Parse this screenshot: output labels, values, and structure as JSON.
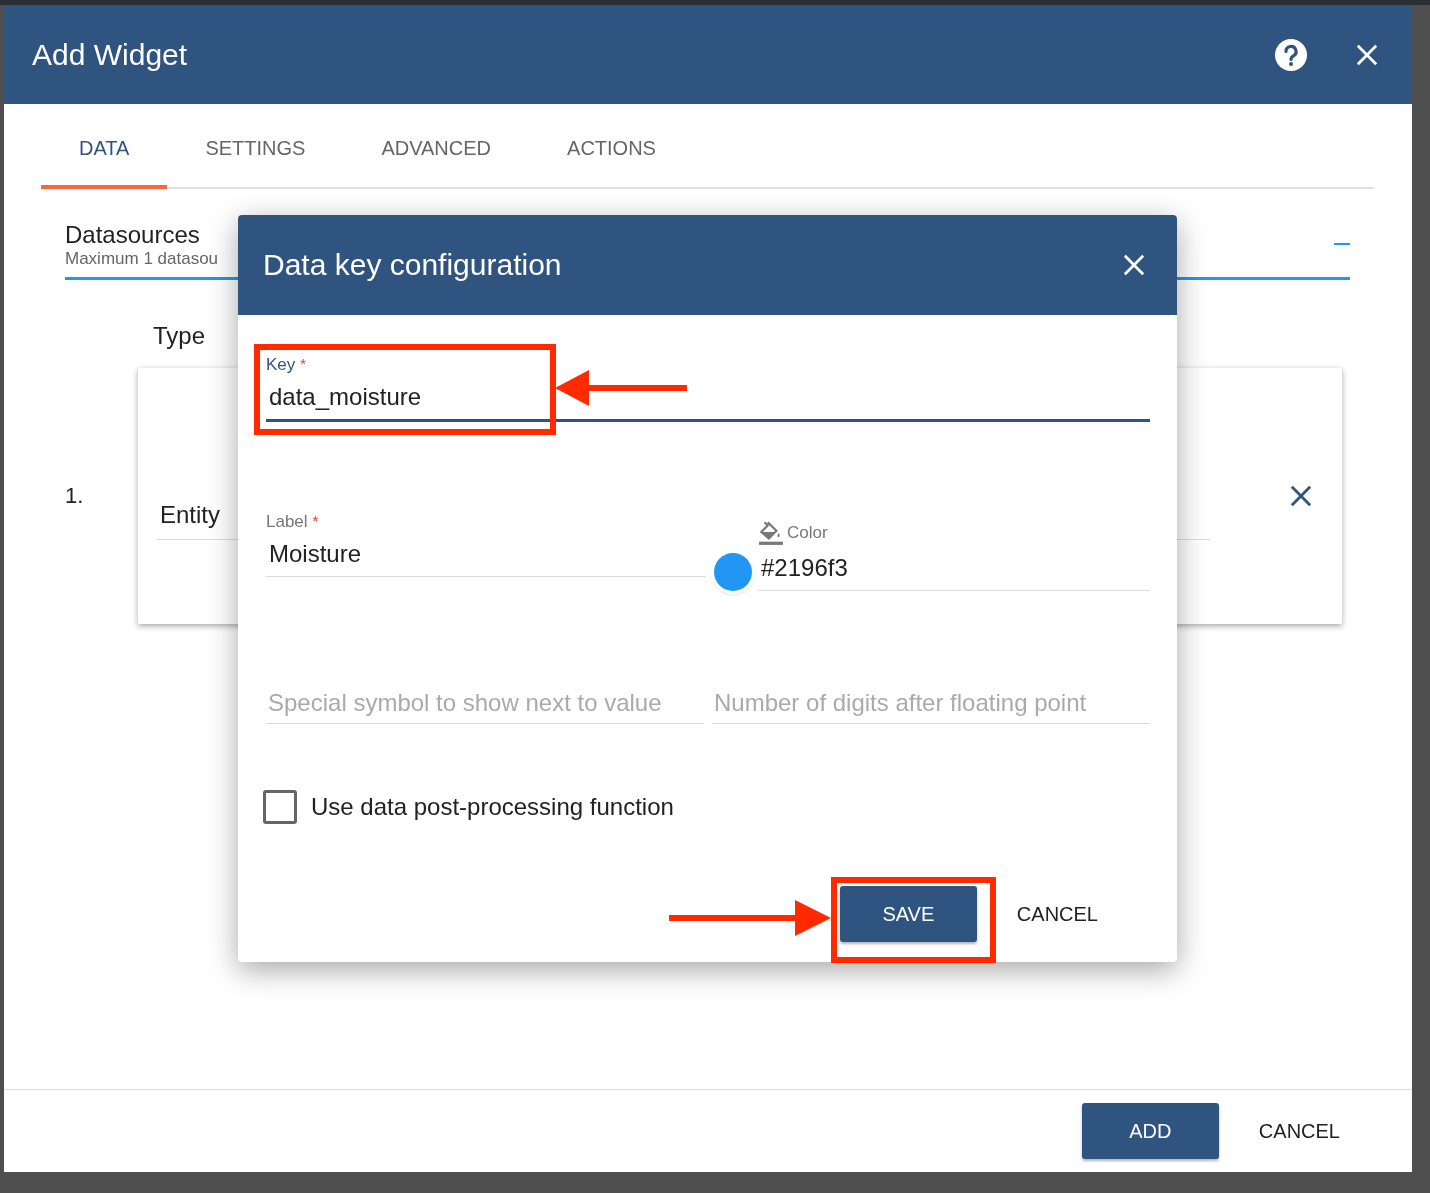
{
  "window": {
    "title": "Add Widget"
  },
  "tabs": [
    {
      "label": "DATA",
      "selected": true
    },
    {
      "label": "SETTINGS",
      "selected": false
    },
    {
      "label": "ADVANCED",
      "selected": false
    },
    {
      "label": "ACTIONS",
      "selected": false
    }
  ],
  "datasources": {
    "title": "Datasources",
    "subtitle": "Maximum 1 datasou",
    "type_label": "Type",
    "rows": [
      {
        "number": "1.",
        "type": "Entity"
      }
    ]
  },
  "footer_buttons": [
    {
      "label": "ADD",
      "kind": "primary"
    },
    {
      "label": "CANCEL",
      "kind": "text"
    }
  ],
  "dialog": {
    "title": "Data key configuration",
    "key": {
      "label": "Key",
      "required_mark": "*",
      "value": "data_moisture",
      "focused": true
    },
    "label": {
      "label": "Label",
      "required_mark": "*",
      "value": "Moisture",
      "focused": false
    },
    "color": {
      "label": "Color",
      "value": "#2196f3",
      "color": "#2196f3"
    },
    "units": {
      "placeholder": "Special symbol to show next to value"
    },
    "decimals": {
      "placeholder": "Number of digits after floating point"
    },
    "postprocessing": {
      "label": "Use data post-processing function",
      "checked": false
    },
    "buttons": [
      {
        "label": "SAVE",
        "kind": "primary"
      },
      {
        "label": "CANCEL",
        "kind": "text"
      }
    ]
  }
}
